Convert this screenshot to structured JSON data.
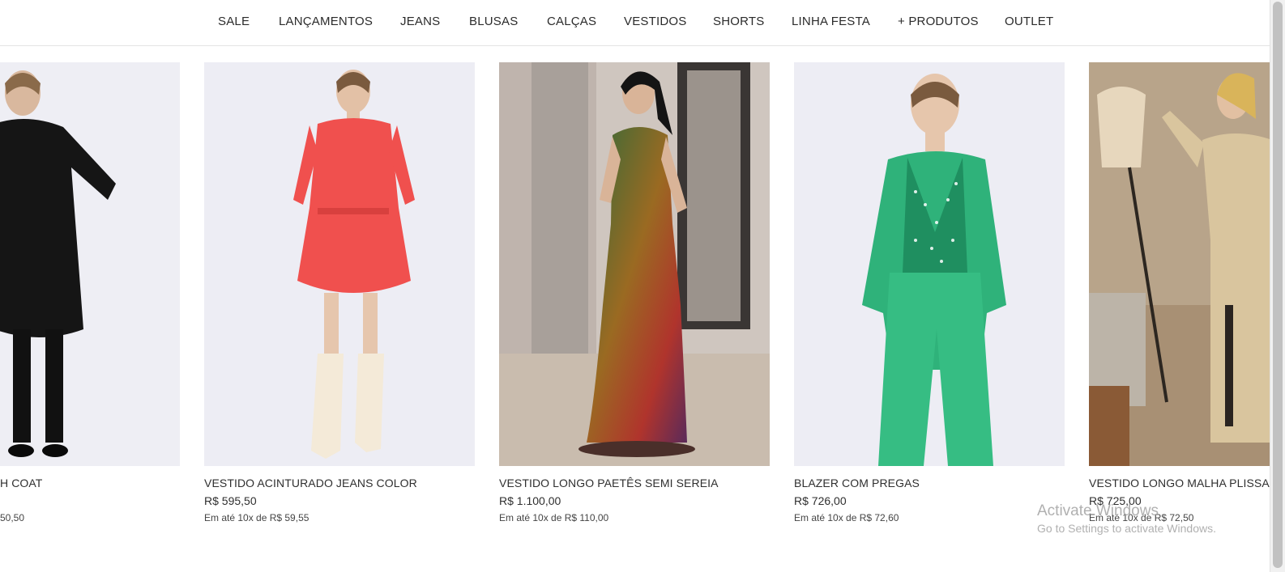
{
  "nav": {
    "items": [
      {
        "label": "SALE"
      },
      {
        "label": "LANÇAMENTOS"
      },
      {
        "label": "JEANS"
      },
      {
        "label": "BLUSAS"
      },
      {
        "label": "CALÇAS"
      },
      {
        "label": "VESTIDOS"
      },
      {
        "label": "SHORTS"
      },
      {
        "label": "LINHA FESTA"
      },
      {
        "label": "+ PRODUTOS"
      },
      {
        "label": "OUTLET"
      }
    ]
  },
  "products": [
    {
      "name": "H COAT",
      "price": "",
      "installments": "50,50",
      "color": "#1a1a1a"
    },
    {
      "name": "VESTIDO ACINTURADO JEANS COLOR",
      "price": "R$ 595,50",
      "installments": "Em até 10x de R$ 59,55",
      "color": "#f0504e"
    },
    {
      "name": "VESTIDO LONGO PAETÊS SEMI SEREIA",
      "price": "R$ 1.100,00",
      "installments": "Em até 10x de R$ 110,00",
      "color": "#7a3a2a"
    },
    {
      "name": "BLAZER COM PREGAS",
      "price": "R$ 726,00",
      "installments": "Em até 10x de R$ 72,60",
      "color": "#2fb27a"
    },
    {
      "name": "VESTIDO LONGO MALHA PLISSA",
      "price": "R$ 725,00",
      "installments": "Em até 10x de R$ 72,50",
      "color": "#cdb99a"
    }
  ],
  "watermark": {
    "title": "Activate Windows",
    "subtitle": "Go to Settings to activate Windows."
  }
}
